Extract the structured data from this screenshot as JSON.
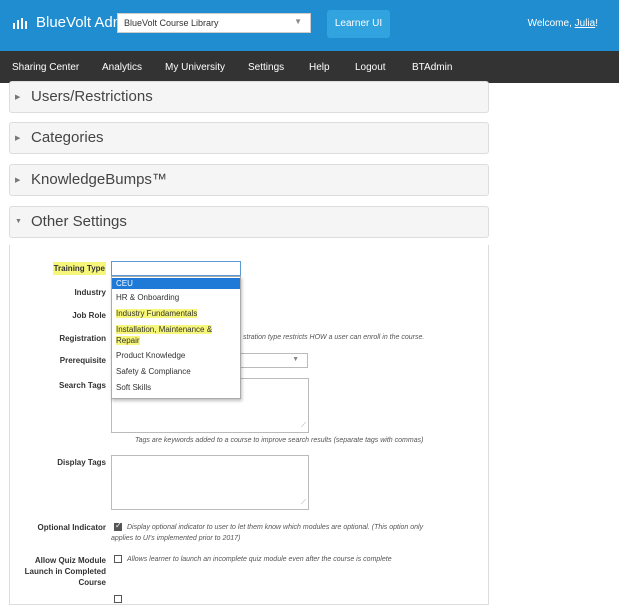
{
  "header": {
    "app_title": "BlueVolt Admin",
    "library_select": "BlueVolt Course Library",
    "learner_button": "Learner UI",
    "welcome_prefix": "Welcome, ",
    "welcome_user": "Julia",
    "welcome_suffix": "!",
    "accent_color": "#1f8dd0"
  },
  "nav": {
    "items": [
      "Sharing Center",
      "Analytics",
      "My University",
      "Settings",
      "Help",
      "Logout",
      "BTAdmin"
    ]
  },
  "panels": [
    {
      "title": "Users/Restrictions",
      "expanded": false
    },
    {
      "title": "Categories",
      "expanded": false
    },
    {
      "title": "KnowledgeBumps™",
      "expanded": false
    },
    {
      "title": "Other Settings",
      "expanded": true
    }
  ],
  "form": {
    "training_type_label": "Training Type",
    "industry_label": "Industry",
    "job_role_label": "Job Role",
    "registration_label": "Registration",
    "registration_help": "stration type restricts HOW a user can enroll in the course.",
    "prerequisite_label": "Prerequisite",
    "search_tags_label": "Search Tags",
    "search_tags_help": "Tags are keywords added to a course to improve search results (separate tags with commas)",
    "display_tags_label": "Display Tags",
    "optional_indicator_label": "Optional Indicator",
    "optional_indicator_checked": true,
    "optional_indicator_help_1": "Display optional indicator to user to let them know which modules are optional. (This option only",
    "optional_indicator_help_2": "applies to UI's implemented prior to 2017)",
    "allow_quiz_label_1": "Allow Quiz Module",
    "allow_quiz_label_2": "Launch in Completed",
    "allow_quiz_label_3": "Course",
    "allow_quiz_checked": false,
    "allow_quiz_help": "Allows learner to launch an incomplete quiz module even after the course is complete"
  },
  "training_type_dropdown": {
    "options": [
      {
        "label": "CEU",
        "selected": true,
        "highlighted": false
      },
      {
        "label": "HR & Onboarding",
        "selected": false,
        "highlighted": false
      },
      {
        "label": "Industry Fundamentals",
        "selected": false,
        "highlighted": true
      },
      {
        "label": "Installation, Maintenance &",
        "selected": false,
        "highlighted": true
      },
      {
        "label": "Repair",
        "selected": false,
        "highlighted": true
      },
      {
        "label": "Product Knowledge",
        "selected": false,
        "highlighted": false
      },
      {
        "label": "Safety & Compliance",
        "selected": false,
        "highlighted": false
      },
      {
        "label": "Soft Skills",
        "selected": false,
        "highlighted": false
      }
    ]
  }
}
